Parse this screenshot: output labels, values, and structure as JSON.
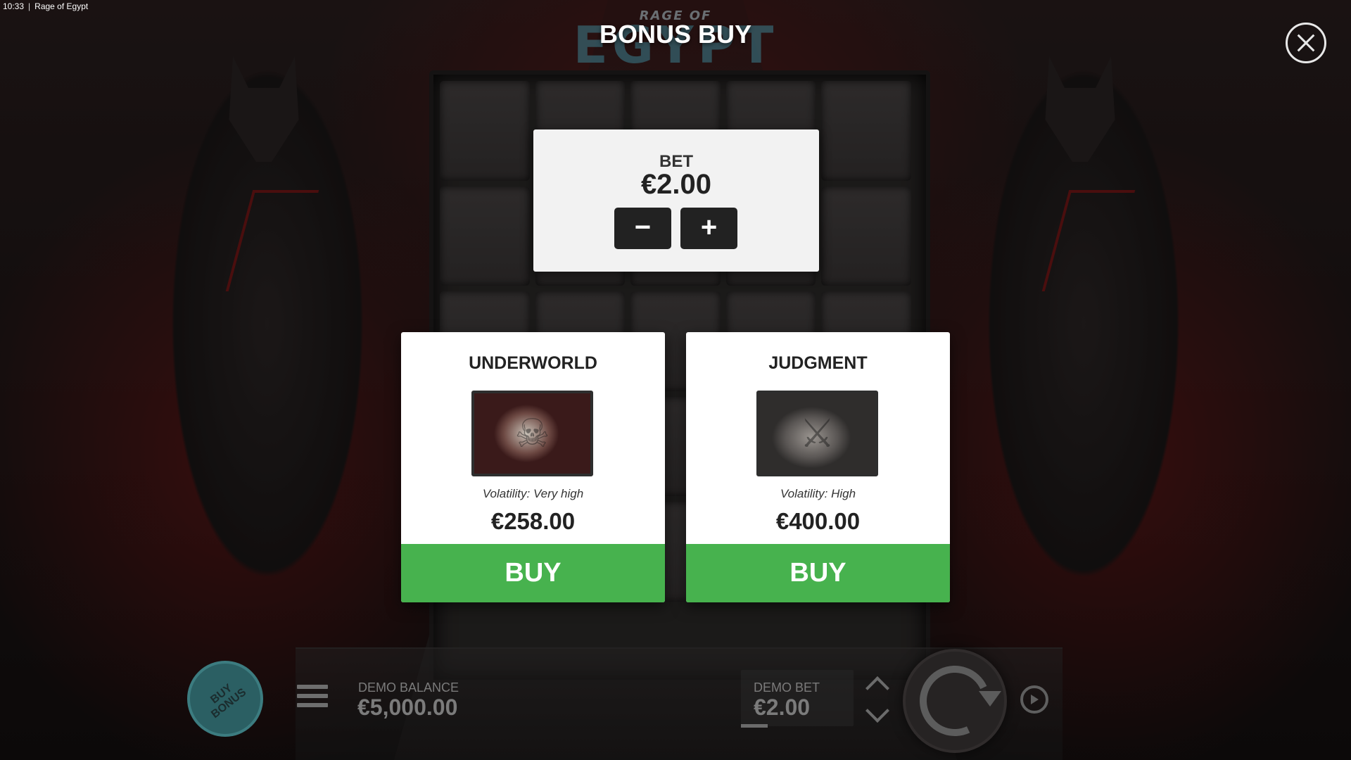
{
  "status_bar": {
    "time": "10:33",
    "separator": "|",
    "window_title": "Rage of Egypt"
  },
  "logo": {
    "line1": "RAGE OF",
    "line2": "EGYPT"
  },
  "overlay": {
    "title": "BONUS BUY"
  },
  "close": {
    "icon": "close-icon"
  },
  "bet_panel": {
    "label": "BET",
    "value": "€2.00",
    "minus_label": "−",
    "plus_label": "+"
  },
  "bonus_options": [
    {
      "name": "UNDERWORLD",
      "image_icon": "reaper-icon",
      "volatility": "Volatility: Very high",
      "price": "€258.00",
      "buy_label": "BUY"
    },
    {
      "name": "JUDGMENT",
      "image_icon": "beast-icon",
      "volatility": "Volatility: High",
      "price": "€400.00",
      "buy_label": "BUY"
    }
  ],
  "bottom_bar": {
    "buy_bonus_line1": "BUY",
    "buy_bonus_line2": "BONUS",
    "balance_label": "DEMO BALANCE",
    "balance_value": "€5,000.00",
    "bet_label": "DEMO BET",
    "bet_value": "€2.00"
  },
  "colors": {
    "buy_green": "#47b24e",
    "panel_bg": "#f2f2f2",
    "buy_bonus_teal": "#2b5f63"
  }
}
